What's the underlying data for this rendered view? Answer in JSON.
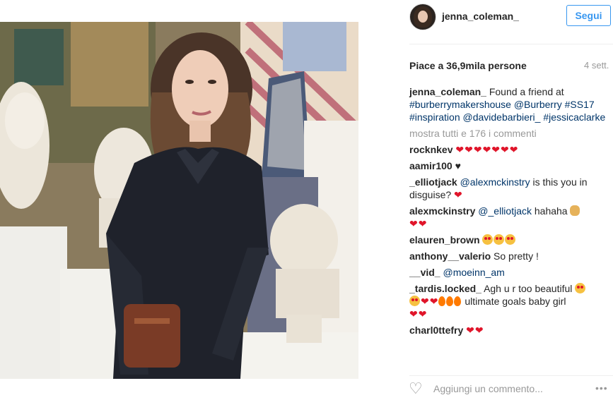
{
  "post": {
    "username": "jenna_coleman_",
    "follow_label": "Segui",
    "likes": "Piace a 36,9mila persone",
    "time": "4 sett.",
    "caption_user": "jenna_coleman_",
    "caption_text": "Found a friend at",
    "caption_tags": "#burberrymakershouse @Burberry #SS17 #inspiration @davidebarbieri_ #jessicaclarke",
    "show_all": "mostra tutti e 176 i commenti",
    "comments": [
      {
        "user": "rocknkev",
        "text": "❤❤❤❤❤❤❤"
      },
      {
        "user": "aamir100",
        "text": "♥"
      },
      {
        "user": "_elliotjack",
        "mention": "@alexmckinstry",
        "text": "is this you in disguise?",
        "emoji": "❤"
      },
      {
        "user": "alexmckinstry",
        "mention": "@_elliotjack",
        "text": "hahaha",
        "emoji": "❤❤"
      },
      {
        "user": "elauren_brown",
        "text": ""
      },
      {
        "user": "anthony__valerio",
        "text": "So pretty !"
      },
      {
        "user": "__vid_",
        "mention": "@moeinn_am",
        "text": ""
      },
      {
        "user": "_tardis.locked_",
        "text": "Agh u r too beautiful",
        "text2": "ultimate goals baby girl",
        "emoji": "❤❤"
      },
      {
        "user": "charl0ttefry",
        "text": "❤❤"
      }
    ],
    "add_comment_placeholder": "Aggiungi un commento...",
    "more_label": "•••"
  },
  "icons": {
    "like": "heart-outline-icon",
    "more": "more-dots-icon"
  },
  "colors": {
    "accent": "#3897f0",
    "link": "#003569",
    "muted": "#999999",
    "heart": "#e0152a"
  }
}
